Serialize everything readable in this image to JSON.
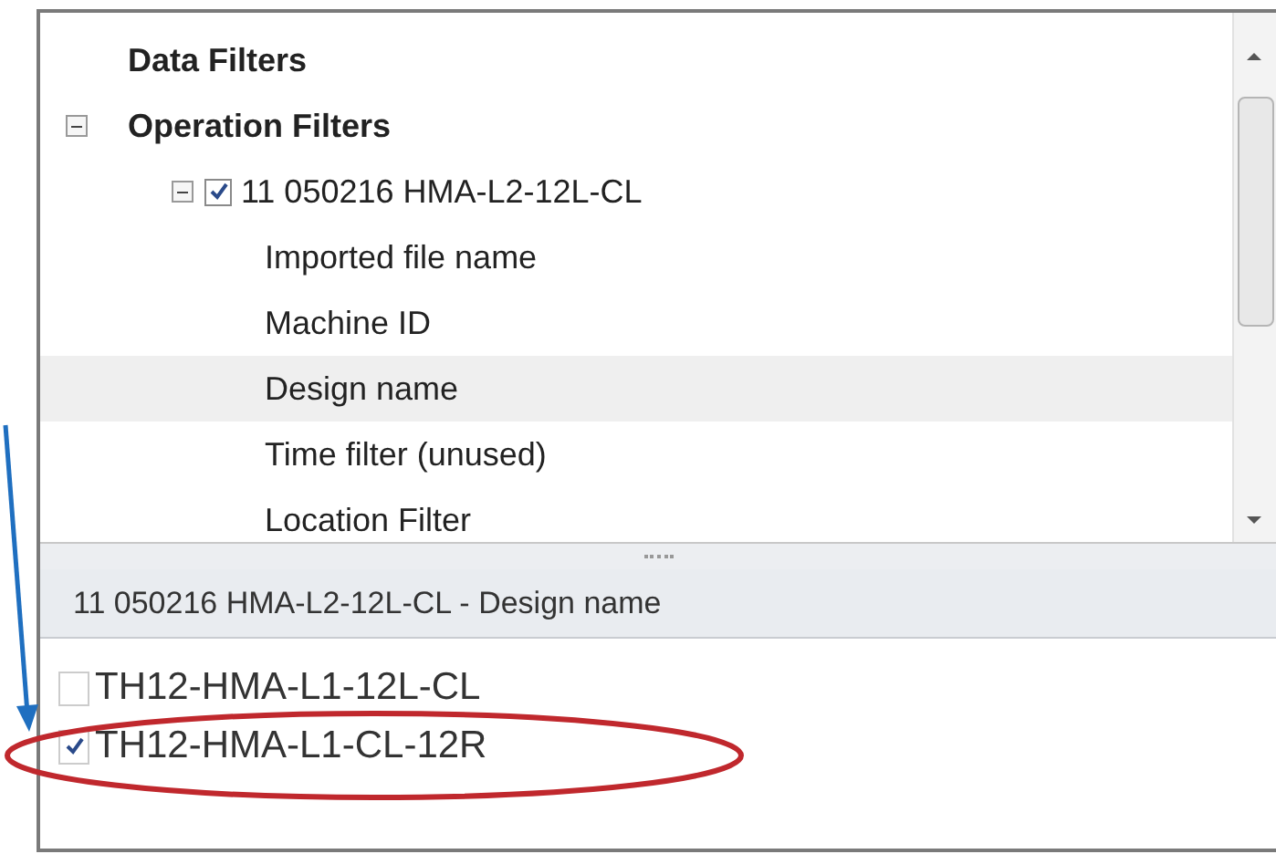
{
  "tree": [
    {
      "label": "Data Filters",
      "selected": false
    },
    {
      "label": "Operation Filters",
      "selected": false,
      "expanded": true,
      "children": [
        {
          "label": "11 050216 HMA-L2-12L-CL",
          "selected": false,
          "expanded": true,
          "checked": true,
          "children": [
            {
              "label": "Imported file name",
              "selected": false
            },
            {
              "label": "Machine ID",
              "selected": false
            },
            {
              "label": "Design name",
              "selected": true
            },
            {
              "label": "Time filter (unused)",
              "selected": false
            },
            {
              "label": "Location Filter",
              "selected": false
            }
          ]
        }
      ]
    }
  ],
  "detail_header": "11 050216 HMA-L2-12L-CL - Design name",
  "values": [
    {
      "label": "TH12-HMA-L1-12L-CL",
      "checked": false
    },
    {
      "label": "TH12-HMA-L1-CL-12R",
      "checked": true
    }
  ]
}
